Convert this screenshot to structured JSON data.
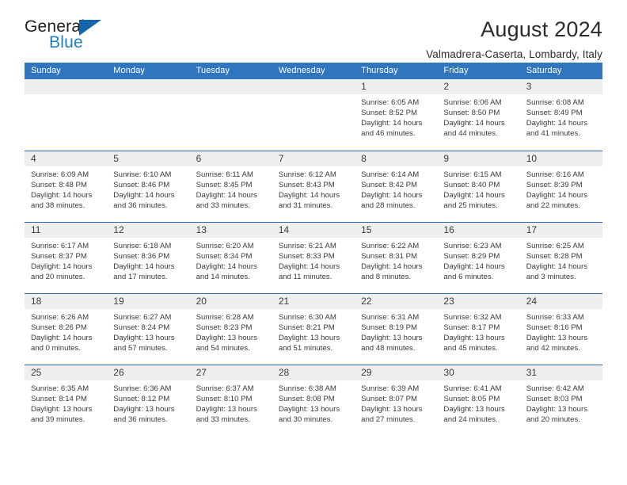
{
  "logo": {
    "word_top": "General",
    "word_bottom": "Blue",
    "triangle_color": "#1566a8",
    "blue_color": "#1f7fc4"
  },
  "header": {
    "month_title": "August 2024",
    "location": "Valmadrera-Caserta, Lombardy, Italy"
  },
  "calendar": {
    "accent_color": "#3076be",
    "weekdays": [
      "Sunday",
      "Monday",
      "Tuesday",
      "Wednesday",
      "Thursday",
      "Friday",
      "Saturday"
    ],
    "weeks": [
      [
        {
          "day": "",
          "empty": true
        },
        {
          "day": "",
          "empty": true
        },
        {
          "day": "",
          "empty": true
        },
        {
          "day": "",
          "empty": true
        },
        {
          "day": "1",
          "sunrise": "Sunrise: 6:05 AM",
          "sunset": "Sunset: 8:52 PM",
          "daylight1": "Daylight: 14 hours",
          "daylight2": "and 46 minutes."
        },
        {
          "day": "2",
          "sunrise": "Sunrise: 6:06 AM",
          "sunset": "Sunset: 8:50 PM",
          "daylight1": "Daylight: 14 hours",
          "daylight2": "and 44 minutes."
        },
        {
          "day": "3",
          "sunrise": "Sunrise: 6:08 AM",
          "sunset": "Sunset: 8:49 PM",
          "daylight1": "Daylight: 14 hours",
          "daylight2": "and 41 minutes."
        }
      ],
      [
        {
          "day": "4",
          "sunrise": "Sunrise: 6:09 AM",
          "sunset": "Sunset: 8:48 PM",
          "daylight1": "Daylight: 14 hours",
          "daylight2": "and 38 minutes."
        },
        {
          "day": "5",
          "sunrise": "Sunrise: 6:10 AM",
          "sunset": "Sunset: 8:46 PM",
          "daylight1": "Daylight: 14 hours",
          "daylight2": "and 36 minutes."
        },
        {
          "day": "6",
          "sunrise": "Sunrise: 6:11 AM",
          "sunset": "Sunset: 8:45 PM",
          "daylight1": "Daylight: 14 hours",
          "daylight2": "and 33 minutes."
        },
        {
          "day": "7",
          "sunrise": "Sunrise: 6:12 AM",
          "sunset": "Sunset: 8:43 PM",
          "daylight1": "Daylight: 14 hours",
          "daylight2": "and 31 minutes."
        },
        {
          "day": "8",
          "sunrise": "Sunrise: 6:14 AM",
          "sunset": "Sunset: 8:42 PM",
          "daylight1": "Daylight: 14 hours",
          "daylight2": "and 28 minutes."
        },
        {
          "day": "9",
          "sunrise": "Sunrise: 6:15 AM",
          "sunset": "Sunset: 8:40 PM",
          "daylight1": "Daylight: 14 hours",
          "daylight2": "and 25 minutes."
        },
        {
          "day": "10",
          "sunrise": "Sunrise: 6:16 AM",
          "sunset": "Sunset: 8:39 PM",
          "daylight1": "Daylight: 14 hours",
          "daylight2": "and 22 minutes."
        }
      ],
      [
        {
          "day": "11",
          "sunrise": "Sunrise: 6:17 AM",
          "sunset": "Sunset: 8:37 PM",
          "daylight1": "Daylight: 14 hours",
          "daylight2": "and 20 minutes."
        },
        {
          "day": "12",
          "sunrise": "Sunrise: 6:18 AM",
          "sunset": "Sunset: 8:36 PM",
          "daylight1": "Daylight: 14 hours",
          "daylight2": "and 17 minutes."
        },
        {
          "day": "13",
          "sunrise": "Sunrise: 6:20 AM",
          "sunset": "Sunset: 8:34 PM",
          "daylight1": "Daylight: 14 hours",
          "daylight2": "and 14 minutes."
        },
        {
          "day": "14",
          "sunrise": "Sunrise: 6:21 AM",
          "sunset": "Sunset: 8:33 PM",
          "daylight1": "Daylight: 14 hours",
          "daylight2": "and 11 minutes."
        },
        {
          "day": "15",
          "sunrise": "Sunrise: 6:22 AM",
          "sunset": "Sunset: 8:31 PM",
          "daylight1": "Daylight: 14 hours",
          "daylight2": "and 8 minutes."
        },
        {
          "day": "16",
          "sunrise": "Sunrise: 6:23 AM",
          "sunset": "Sunset: 8:29 PM",
          "daylight1": "Daylight: 14 hours",
          "daylight2": "and 6 minutes."
        },
        {
          "day": "17",
          "sunrise": "Sunrise: 6:25 AM",
          "sunset": "Sunset: 8:28 PM",
          "daylight1": "Daylight: 14 hours",
          "daylight2": "and 3 minutes."
        }
      ],
      [
        {
          "day": "18",
          "sunrise": "Sunrise: 6:26 AM",
          "sunset": "Sunset: 8:26 PM",
          "daylight1": "Daylight: 14 hours",
          "daylight2": "and 0 minutes."
        },
        {
          "day": "19",
          "sunrise": "Sunrise: 6:27 AM",
          "sunset": "Sunset: 8:24 PM",
          "daylight1": "Daylight: 13 hours",
          "daylight2": "and 57 minutes."
        },
        {
          "day": "20",
          "sunrise": "Sunrise: 6:28 AM",
          "sunset": "Sunset: 8:23 PM",
          "daylight1": "Daylight: 13 hours",
          "daylight2": "and 54 minutes."
        },
        {
          "day": "21",
          "sunrise": "Sunrise: 6:30 AM",
          "sunset": "Sunset: 8:21 PM",
          "daylight1": "Daylight: 13 hours",
          "daylight2": "and 51 minutes."
        },
        {
          "day": "22",
          "sunrise": "Sunrise: 6:31 AM",
          "sunset": "Sunset: 8:19 PM",
          "daylight1": "Daylight: 13 hours",
          "daylight2": "and 48 minutes."
        },
        {
          "day": "23",
          "sunrise": "Sunrise: 6:32 AM",
          "sunset": "Sunset: 8:17 PM",
          "daylight1": "Daylight: 13 hours",
          "daylight2": "and 45 minutes."
        },
        {
          "day": "24",
          "sunrise": "Sunrise: 6:33 AM",
          "sunset": "Sunset: 8:16 PM",
          "daylight1": "Daylight: 13 hours",
          "daylight2": "and 42 minutes."
        }
      ],
      [
        {
          "day": "25",
          "sunrise": "Sunrise: 6:35 AM",
          "sunset": "Sunset: 8:14 PM",
          "daylight1": "Daylight: 13 hours",
          "daylight2": "and 39 minutes."
        },
        {
          "day": "26",
          "sunrise": "Sunrise: 6:36 AM",
          "sunset": "Sunset: 8:12 PM",
          "daylight1": "Daylight: 13 hours",
          "daylight2": "and 36 minutes."
        },
        {
          "day": "27",
          "sunrise": "Sunrise: 6:37 AM",
          "sunset": "Sunset: 8:10 PM",
          "daylight1": "Daylight: 13 hours",
          "daylight2": "and 33 minutes."
        },
        {
          "day": "28",
          "sunrise": "Sunrise: 6:38 AM",
          "sunset": "Sunset: 8:08 PM",
          "daylight1": "Daylight: 13 hours",
          "daylight2": "and 30 minutes."
        },
        {
          "day": "29",
          "sunrise": "Sunrise: 6:39 AM",
          "sunset": "Sunset: 8:07 PM",
          "daylight1": "Daylight: 13 hours",
          "daylight2": "and 27 minutes."
        },
        {
          "day": "30",
          "sunrise": "Sunrise: 6:41 AM",
          "sunset": "Sunset: 8:05 PM",
          "daylight1": "Daylight: 13 hours",
          "daylight2": "and 24 minutes."
        },
        {
          "day": "31",
          "sunrise": "Sunrise: 6:42 AM",
          "sunset": "Sunset: 8:03 PM",
          "daylight1": "Daylight: 13 hours",
          "daylight2": "and 20 minutes."
        }
      ]
    ]
  }
}
